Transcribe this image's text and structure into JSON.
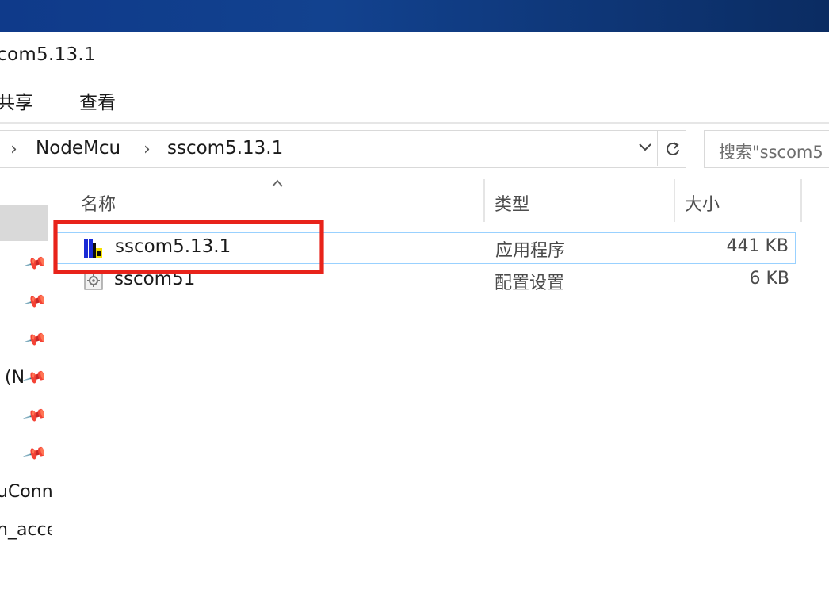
{
  "window": {
    "title": "com5.13.1"
  },
  "ribbon": {
    "tabs": [
      "共享",
      "查看"
    ]
  },
  "address_bar": {
    "breadcrumbs": [
      "NodeMcu",
      "sscom5.13.1"
    ],
    "separator": "›",
    "dropdown_icon": "chevron-down",
    "refresh_icon": "refresh"
  },
  "search": {
    "placeholder": "搜索\"sscom5"
  },
  "nav_pane": {
    "items": [
      "(N",
      "uConn",
      "n_acce"
    ],
    "pin_icon": "pin"
  },
  "columns": {
    "name": "名称",
    "type": "类型",
    "size": "大小"
  },
  "files": [
    {
      "name": "sscom5.13.1",
      "type": "应用程序",
      "size": "441 KB",
      "icon": "application-icon",
      "selected": true
    },
    {
      "name": "sscom51",
      "type": "配置设置",
      "size": "6 KB",
      "icon": "config-settings-icon",
      "selected": false
    }
  ],
  "colors": {
    "accent": "#99d1ff",
    "highlight": "#e8231a",
    "titlebar": "#12428f"
  }
}
